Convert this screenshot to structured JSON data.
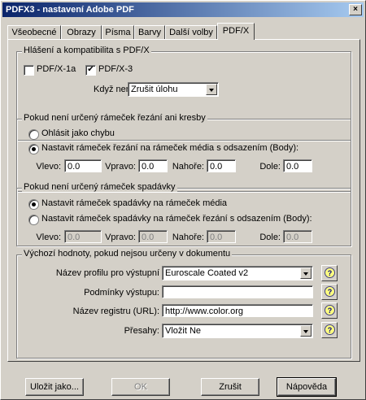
{
  "window": {
    "title": "PDFX3 - nastavení Adobe PDF",
    "close_label": "×"
  },
  "tabs": [
    {
      "label": "Všeobecné"
    },
    {
      "label": "Obrazy"
    },
    {
      "label": "Písma"
    },
    {
      "label": "Barvy"
    },
    {
      "label": "Další volby"
    },
    {
      "label": "PDF/X",
      "active": true
    }
  ],
  "compat": {
    "legend": "Hlášení a kompatibilita s PDF/X",
    "pdfx1a": {
      "label": "PDF/X-1a",
      "checked": false
    },
    "pdfx3": {
      "label": "PDF/X-3",
      "checked": true
    },
    "when_not_label": "Když není",
    "when_not_value": "Zrušit úlohu"
  },
  "trim": {
    "legend": "Pokud není určený rámeček řezání ani kresby",
    "opt1": "Ohlásit jako chybu",
    "opt2": "Nastavit rámeček řezání na rámeček média s odsazením (Body):",
    "selected": 2,
    "left_label": "Vlevo:",
    "left_value": "0.0",
    "right_label": "Vpravo:",
    "right_value": "0.0",
    "top_label": "Nahoře:",
    "top_value": "0.0",
    "bottom_label": "Dole:",
    "bottom_value": "0.0"
  },
  "bleed": {
    "legend": "Pokud není určený rámeček spadávky",
    "opt1": "Nastavit rámeček spadávky na rámeček média",
    "opt2": "Nastavit rámeček spadávky na rámeček řezání s odsazením (Body):",
    "selected": 1,
    "left_label": "Vlevo:",
    "left_value": "0.0",
    "right_label": "Vpravo:",
    "right_value": "0.0",
    "top_label": "Nahoře:",
    "top_value": "0.0",
    "bottom_label": "Dole:",
    "bottom_value": "0.0"
  },
  "defaults": {
    "legend": "Výchozí hodnoty, pokud nejsou určeny v dokumentu",
    "profile_label": "Název profilu pro výstupní",
    "profile_value": "Euroscale Coated v2",
    "conditions_label": "Podmínky výstupu:",
    "conditions_value": "",
    "registry_label": "Název registru (URL):",
    "registry_value": "http://www.color.org",
    "trapped_label": "Přesahy:",
    "trapped_value": "Vložit Ne"
  },
  "buttons": {
    "save_as": "Uložit jako...",
    "ok": "OK",
    "cancel": "Zrušit",
    "help": "Nápověda"
  }
}
